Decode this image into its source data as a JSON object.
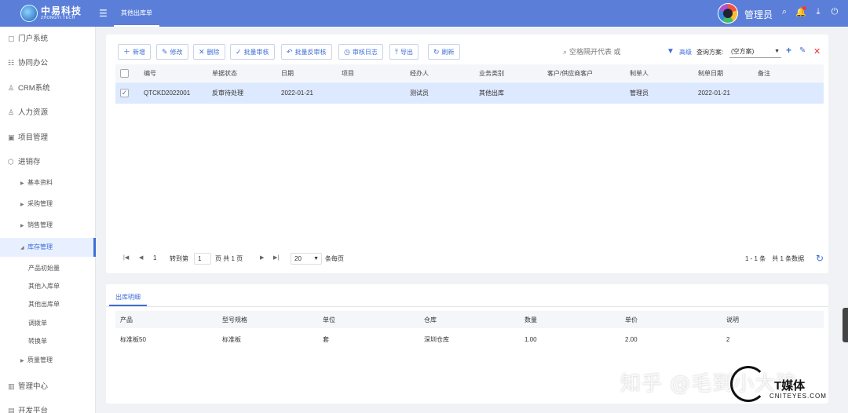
{
  "brand": {
    "name": "中易科技",
    "sub": "ZHONGYI TECH"
  },
  "header": {
    "tab": "其他出库单",
    "user": "管理员"
  },
  "sidebar": {
    "top_items": [
      {
        "label": "门户系统",
        "icon": "square-icon"
      },
      {
        "label": "协同办公",
        "icon": "grid-icon"
      },
      {
        "label": "CRM系统",
        "icon": "user-icon"
      },
      {
        "label": "人力资源",
        "icon": "people-icon"
      },
      {
        "label": "项目管理",
        "icon": "calendar-icon"
      },
      {
        "label": "进销存",
        "icon": "box-icon"
      }
    ],
    "sub_items": [
      "基本资料",
      "采购管理",
      "销售管理",
      "库存管理"
    ],
    "leaf_items": [
      "产品初始量",
      "其他入库单",
      "其他出库单",
      "调拨单",
      "转换单"
    ],
    "quality": "质量管理",
    "bottom_items": [
      "管理中心",
      "开发平台"
    ]
  },
  "toolbar": {
    "add": "新增",
    "edit": "修改",
    "delete": "删除",
    "batch_approve": "批量审核",
    "batch_unapprove": "批量反审核",
    "audit_log": "审核日志",
    "export": "导出",
    "refresh": "刷新"
  },
  "search": {
    "placeholder": "空格隔开代表 或"
  },
  "query": {
    "advanced": "高级",
    "plan_label": "查询方案:",
    "plan_value": "(空方案)"
  },
  "grid": {
    "columns": [
      "编号",
      "单据状态",
      "日期",
      "项目",
      "经办人",
      "业务类别",
      "客户/供应商客户",
      "制单人",
      "制单日期",
      "备注"
    ],
    "rows": [
      [
        "QTCKD2022001",
        "反审待处理",
        "2022-01-21",
        "",
        "测试员",
        "其他出库",
        "",
        "管理员",
        "2022-01-21",
        ""
      ]
    ]
  },
  "pager": {
    "page_current": "1",
    "goto_label": "转到第",
    "page_input": "1",
    "page_total": "页 共 1 页",
    "page_size": "20",
    "per_page_label": "条每页",
    "summary": "1 - 1 条　共 1 条数据"
  },
  "detail": {
    "tab": "出库明细",
    "columns": [
      "产品",
      "型号规格",
      "单位",
      "仓库",
      "数量",
      "单价",
      "说明"
    ],
    "rows": [
      [
        "标准板50",
        "标准板",
        "套",
        "深圳仓库",
        "1.00",
        "2.00",
        "2"
      ]
    ]
  },
  "watermark": {
    "text": "知乎 @毛到小大狼",
    "logo": "T媒体",
    "logo_sub": "CNITEYES.COM"
  }
}
